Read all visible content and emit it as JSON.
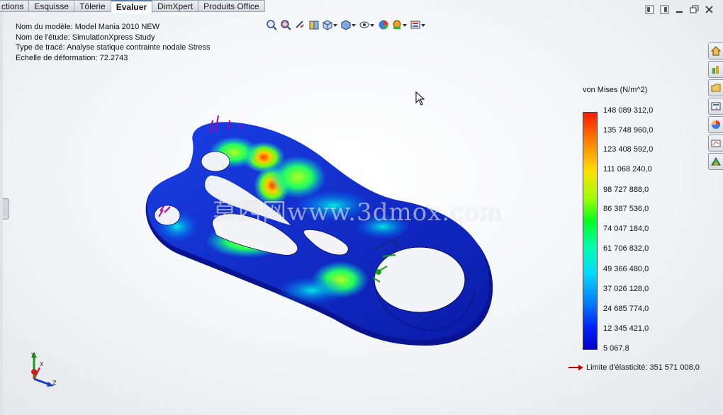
{
  "tabs": [
    {
      "label": "ctions",
      "active": false
    },
    {
      "label": "Esquisse",
      "active": false
    },
    {
      "label": "Tôlerie",
      "active": false
    },
    {
      "label": "Evaluer",
      "active": true
    },
    {
      "label": "DimXpert",
      "active": false
    },
    {
      "label": "Produits Office",
      "active": false
    }
  ],
  "info": {
    "model": "Nom du modèle: Model Mania 2010 NEW",
    "study": "Nom de l'étude: SimulationXpress Study",
    "plot_type": "Type de tracé: Analyse statique contrainte nodale Stress",
    "deformation": "Echelle de déformation: 72.2743"
  },
  "view_toolbar_icons": [
    "zoom-to-fit-icon",
    "zoom-to-area-icon",
    "previous-view-icon",
    "section-view-icon",
    "view-orientation-icon",
    "display-style-icon",
    "hide-show-items-icon",
    "edit-appearance-icon",
    "apply-scene-icon",
    "view-settings-icon"
  ],
  "window_controls": [
    "tile-left-icon",
    "tile-right-icon",
    "minimize-icon",
    "restore-icon",
    "close-icon"
  ],
  "task_pane_icons": [
    "home-icon",
    "design-library-icon",
    "file-explorer-icon",
    "view-palette-icon",
    "appearances-icon",
    "custom-properties-icon",
    "simulation-icon"
  ],
  "legend": {
    "title": "von Mises (N/m^2)",
    "labels": [
      "148 089 312,0",
      "135 748 960,0",
      "123 408 592,0",
      "111 068 240,0",
      "98 727 888,0",
      "86 387 536,0",
      "74 047 184,0",
      "61 706 832,0",
      "49 366 480,0",
      "37 026 128,0",
      "24 685 774,0",
      "12 345 421,0",
      "5 067,8"
    ],
    "yield_label": "Limite d'élasticité: 351 571 008,0"
  },
  "watermark": "莫西网www.3dmox.com",
  "triad": {
    "x": "X",
    "y": "Y",
    "z": "Z"
  },
  "colors": {
    "min": "#0000c8",
    "max": "#ff1a00",
    "part_base": "#1530d8",
    "yield_arrow": "#c00000"
  }
}
